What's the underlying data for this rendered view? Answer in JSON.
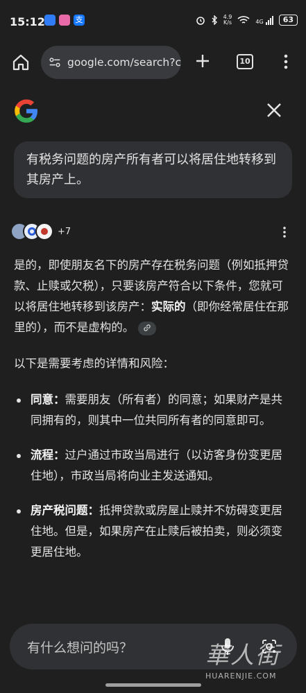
{
  "status": {
    "time": "15:12",
    "net_speed_value": "4.9",
    "net_speed_unit": "K/s",
    "signal_label": "4G",
    "battery": "63"
  },
  "browser": {
    "url": "google.com/search?c",
    "tab_count": "10"
  },
  "overlay": {
    "query": "有税务问题的房产所有者可以将居住地转移到其房产上。",
    "sources_count": "+7",
    "answer": {
      "intro_pre": "是的，即使朋友名下的房产存在税务问题（例如抵押贷款、止赎或欠税），只要该房产符合以下条件，您就可以将居住地转移到该房产：",
      "intro_bold": "实际的",
      "intro_post": "（即你经常居住在那里的），而不是虚构的。",
      "details_heading": "以下是需要考虑的详情和风险：",
      "bullets": [
        {
          "label": "同意：",
          "text": "需要朋友（所有者）的同意；如果财产是共同拥有的，则其中一位共同所有者的同意即可。"
        },
        {
          "label": "流程：",
          "text": "过户通过市政当局进行（以访客身份变更居住地），市政当局将向业主发送通知。"
        },
        {
          "label": "房产税问题：",
          "text": "抵押贷款或房屋止赎并不妨碍变更居住地。但是，如果房产在止赎后被拍卖，则必须变更居住地。"
        }
      ]
    },
    "ask_placeholder": "有什么想问的吗？"
  },
  "watermark": {
    "text_cn": "華人街",
    "text_en": "HUARENJIE.COM"
  },
  "colors": {
    "background": "#1f1f1f",
    "bubble": "#303134",
    "omnibox": "#383a3e",
    "text": "#e3e3e3"
  }
}
